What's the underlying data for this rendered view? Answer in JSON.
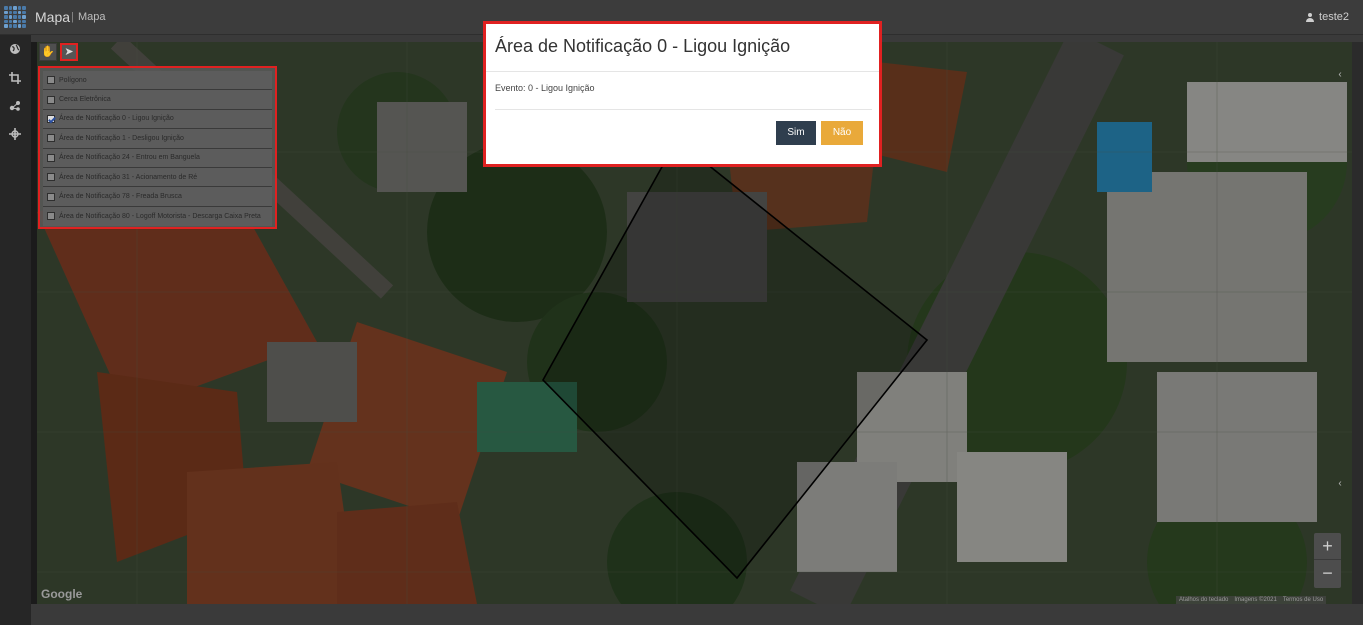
{
  "header": {
    "brand": "Mapa",
    "separator": "|",
    "breadcrumb": "Mapa",
    "user": "teste2"
  },
  "sidebar": {
    "icons": [
      "globe-icon",
      "crop-icon",
      "share-nodes-icon",
      "crosshair-icon"
    ]
  },
  "map_tools": {
    "hand_tool": "hand-icon",
    "select_tool": "pointer-icon"
  },
  "layers": [
    {
      "label": "Polígono",
      "checked": false
    },
    {
      "label": "Cerca Eletrônica",
      "checked": false
    },
    {
      "label": "Área de Notificação 0 - Ligou Ignição",
      "checked": true
    },
    {
      "label": "Área de Notificação 1 - Desligou Ignição",
      "checked": false
    },
    {
      "label": "Área de Notificação 24 - Entrou em Banguela",
      "checked": false
    },
    {
      "label": "Área de Notificação 31 - Acionamento de Ré",
      "checked": false
    },
    {
      "label": "Área de Notificação 78 - Freada Brusca",
      "checked": false
    },
    {
      "label": "Área de Notificação 80 - Logoff Motorista - Descarga Caixa Preta",
      "checked": false
    }
  ],
  "modal": {
    "title": "Área de Notificação 0 - Ligou Ignição",
    "body": "Evento: 0 - Ligou Ignição",
    "confirm_label": "Sim",
    "cancel_label": "Não"
  },
  "map": {
    "provider": "Google",
    "zoom_in": "+",
    "zoom_out": "−",
    "attribution": [
      "Atalhos do teclado",
      "Imagens ©2021",
      "Termos de Uso"
    ]
  }
}
